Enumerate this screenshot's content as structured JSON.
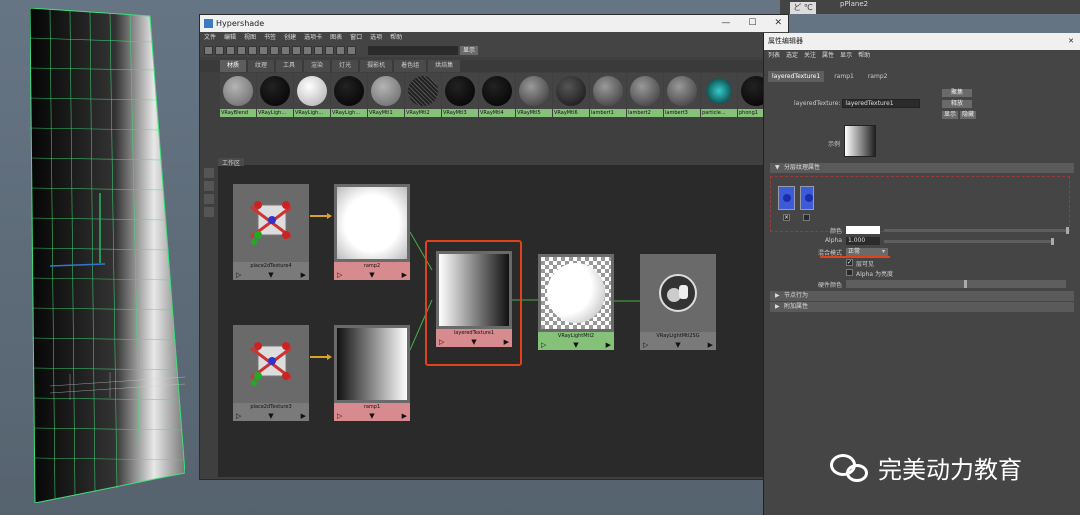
{
  "top_right": {
    "object_label": "pPlane2",
    "icon_text": "ど ℃"
  },
  "hypershade": {
    "title": "Hypershade",
    "win_controls": [
      "—",
      "☐",
      "✕"
    ],
    "menu": [
      "文件",
      "编辑",
      "视图",
      "书签",
      "创建",
      "选项卡",
      "图表",
      "窗口",
      "选项",
      "帮助"
    ],
    "toolbar_label": "显示",
    "tabs": [
      "材质",
      "纹理",
      "工具",
      "渲染",
      "灯光",
      "摄影机",
      "着色组",
      "烘焙集"
    ],
    "swatches": [
      {
        "label": "VRayBlend",
        "kind": "checker-white"
      },
      {
        "label": "VRayLigh...",
        "kind": "black"
      },
      {
        "label": "VRayLigh...",
        "kind": "white"
      },
      {
        "label": "VRayLigh...",
        "kind": "black"
      },
      {
        "label": "VRayMtl1",
        "kind": "checker-white"
      },
      {
        "label": "VRayMtl2",
        "kind": "dark-grid"
      },
      {
        "label": "VRayMtl3",
        "kind": "black"
      },
      {
        "label": "VRayMtl4",
        "kind": "black"
      },
      {
        "label": "VRayMtl5",
        "kind": "grey"
      },
      {
        "label": "VRayMtl6",
        "kind": "checker-black"
      },
      {
        "label": "lambert1",
        "kind": "grey"
      },
      {
        "label": "lambert2",
        "kind": "grey"
      },
      {
        "label": "lambert3",
        "kind": "grey"
      },
      {
        "label": "particle...",
        "kind": "teal"
      },
      {
        "label": "phong1",
        "kind": "black"
      }
    ],
    "work_area_label": "工作区",
    "nodes": {
      "place1": {
        "name": "place2dTexture4"
      },
      "place2": {
        "name": "place2dTexture3"
      },
      "ramp2": {
        "name": "ramp2"
      },
      "ramp1": {
        "name": "ramp1"
      },
      "layered": {
        "name": "layeredTexture1"
      },
      "vraylight": {
        "name": "VRayLightMtl2"
      },
      "vraylightsg": {
        "name": "VRayLightMtl2SG"
      }
    },
    "node_ctrl": [
      "▷",
      "▼",
      "▶"
    ]
  },
  "attribute_editor": {
    "title": "属性编辑器",
    "menu": [
      "列表",
      "选定",
      "关注",
      "属性",
      "显示",
      "帮助"
    ],
    "tabs": [
      "layeredTexture1",
      "ramp1",
      "ramp2"
    ],
    "field_label": "layeredTexture:",
    "field_value": "layeredTexture1",
    "buttons": [
      "聚集",
      "释放",
      "显示",
      "隐藏"
    ],
    "sample_label": "示例",
    "section_layered": "分层纹理属性",
    "color_label": "颜色",
    "alpha_label": "Alpha",
    "alpha_value": "1.000",
    "blend_label": "混合模式",
    "blend_value": "正常",
    "visible_label": "层可见",
    "alpha_is_lum": "Alpha 为亮度",
    "hardware_label": "硬件颜色",
    "section_node": "节点行为",
    "section_extra": "附加属性"
  },
  "watermark": {
    "text": "完美动力教育"
  }
}
